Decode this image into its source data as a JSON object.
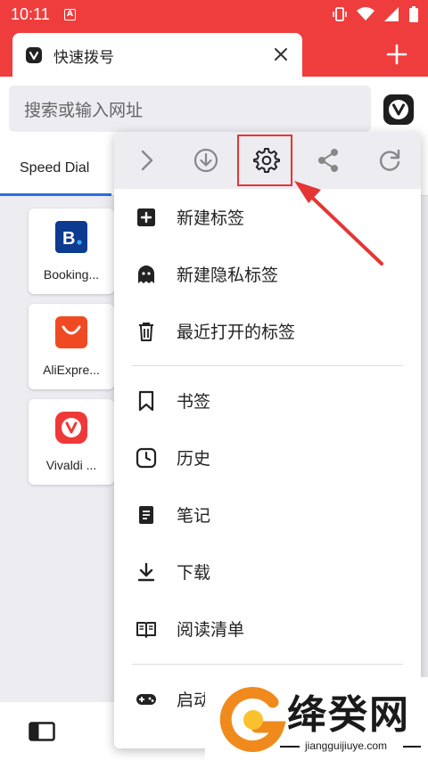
{
  "status_bar": {
    "time": "10:11",
    "notification": "A"
  },
  "tab": {
    "title": "快速拨号"
  },
  "address_bar": {
    "placeholder": "搜索或输入网址"
  },
  "speed_dial": {
    "tab_label": "Speed Dial",
    "tiles": [
      {
        "label": "Booking...",
        "brand_letter": "B.",
        "color": "#0c3b8f"
      },
      {
        "label": "AliExpre...",
        "color": "#f04a23"
      },
      {
        "label": "Vivaldi ...",
        "color": "#ef3939"
      }
    ]
  },
  "menu": {
    "toolbar": [
      "forward-icon",
      "download-icon",
      "settings-icon",
      "share-icon",
      "reload-icon"
    ],
    "items": [
      {
        "label": "新建标签",
        "icon": "add-tab-icon"
      },
      {
        "label": "新建隐私标签",
        "icon": "ghost-icon"
      },
      {
        "label": "最近打开的标签",
        "icon": "trash-icon"
      },
      {
        "label": "书签",
        "icon": "bookmark-icon"
      },
      {
        "label": "历史",
        "icon": "clock-icon"
      },
      {
        "label": "笔记",
        "icon": "notes-icon"
      },
      {
        "label": "下载",
        "icon": "download-icon"
      },
      {
        "label": "阅读清单",
        "icon": "book-icon"
      },
      {
        "label": "启动",
        "icon": "gamepad-icon"
      }
    ]
  },
  "watermark": {
    "title": "绛癸网",
    "subtitle": "jiangguijiuye.com"
  },
  "colors": {
    "accent": "#ef3d3d",
    "highlight": "#e53535",
    "link": "#2a6de0"
  }
}
